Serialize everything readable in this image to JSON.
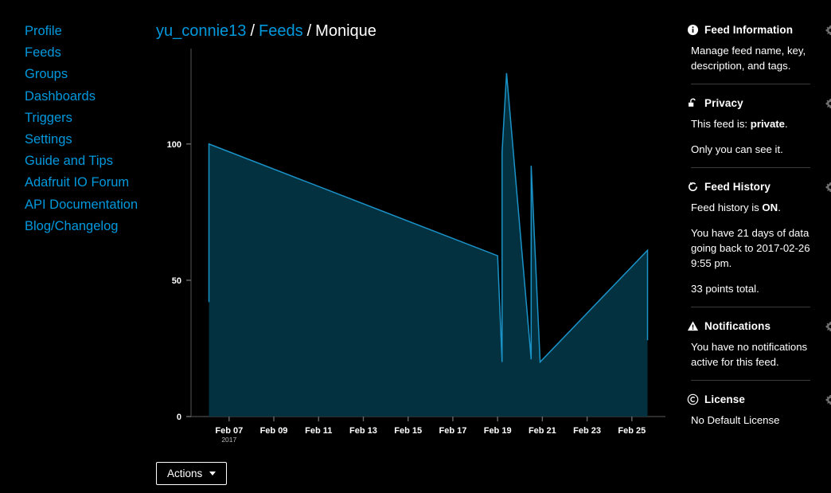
{
  "nav": {
    "items": [
      {
        "label": "Profile",
        "name": "sidebar-item-profile"
      },
      {
        "label": "Feeds",
        "name": "sidebar-item-feeds"
      },
      {
        "label": "Groups",
        "name": "sidebar-item-groups"
      },
      {
        "label": "Dashboards",
        "name": "sidebar-item-dashboards"
      },
      {
        "label": "Triggers",
        "name": "sidebar-item-triggers"
      },
      {
        "label": "Settings",
        "name": "sidebar-item-settings"
      },
      {
        "label": "Guide and Tips",
        "name": "sidebar-item-guide-and-tips"
      },
      {
        "label": "Adafruit IO Forum",
        "name": "sidebar-item-adafruit-io-forum"
      },
      {
        "label": "API Documentation",
        "name": "sidebar-item-api-documentation"
      },
      {
        "label": "Blog/Changelog",
        "name": "sidebar-item-blog-changelog"
      }
    ]
  },
  "breadcrumb": {
    "owner": "yu_connie13",
    "separator": "/",
    "section": "Feeds",
    "current": "Monique"
  },
  "toolbar": {
    "actions_label": "Actions"
  },
  "colors": {
    "link": "#0099dd",
    "series_line": "#1a93c9",
    "series_fill": "#04313f",
    "background": "#000000",
    "text": "#ffffff"
  },
  "panel": {
    "sections": [
      {
        "name": "feed-information",
        "icon": "info-icon",
        "title": "Feed Information",
        "paragraphs": [
          "Manage feed name, key, description, and tags."
        ]
      },
      {
        "name": "privacy",
        "icon": "unlocked-padlock-icon",
        "title": "Privacy",
        "paragraphs": [
          "This feed is: private.",
          "Only you can see it."
        ],
        "value": "private"
      },
      {
        "name": "feed-history",
        "icon": "history-icon",
        "title": "Feed History",
        "paragraphs": [
          "Feed history is ON.",
          "You have 21 days of data going back to 2017-02-26 9:55 pm.",
          "33 points total."
        ],
        "state": "ON",
        "days_of_data": 21,
        "data_start": "2017-02-26 9:55 pm",
        "points_total": 33
      },
      {
        "name": "notifications",
        "icon": "warning-triangle-icon",
        "title": "Notifications",
        "paragraphs": [
          "You have no notifications active for this feed."
        ]
      },
      {
        "name": "license",
        "icon": "copyright-icon",
        "title": "License",
        "paragraphs": [
          "No Default License"
        ]
      }
    ]
  },
  "chart_data": {
    "type": "area",
    "title": "",
    "xlabel": "",
    "ylabel": "",
    "ylim": [
      0,
      135
    ],
    "yticks": [
      0,
      50,
      100
    ],
    "ytick_labels": [
      "0",
      "50",
      "100"
    ],
    "grid": false,
    "legend": false,
    "xtick_labels": [
      "Feb 07",
      "Feb 09",
      "Feb 11",
      "Feb 13",
      "Feb 15",
      "Feb 17",
      "Feb 19",
      "Feb 21",
      "Feb 23",
      "Feb 25"
    ],
    "xtick_sub_labels": [
      "2017",
      "",
      "",
      "",
      "",
      "",
      "",
      "",
      "",
      ""
    ],
    "x_axis_start": "Feb 05",
    "x_axis_end": "Feb 26",
    "series": [
      {
        "name": "Monique",
        "points": [
          {
            "x": "Feb 06.1",
            "y": 42
          },
          {
            "x": "Feb 06.1",
            "y": 100
          },
          {
            "x": "Feb 19.0",
            "y": 59
          },
          {
            "x": "Feb 19.2",
            "y": 20
          },
          {
            "x": "Feb 19.2",
            "y": 97
          },
          {
            "x": "Feb 19.4",
            "y": 126
          },
          {
            "x": "Feb 20.5",
            "y": 21
          },
          {
            "x": "Feb 20.5",
            "y": 92
          },
          {
            "x": "Feb 20.9",
            "y": 20
          },
          {
            "x": "Feb 25.7",
            "y": 61
          },
          {
            "x": "Feb 25.7",
            "y": 28
          }
        ]
      }
    ]
  }
}
